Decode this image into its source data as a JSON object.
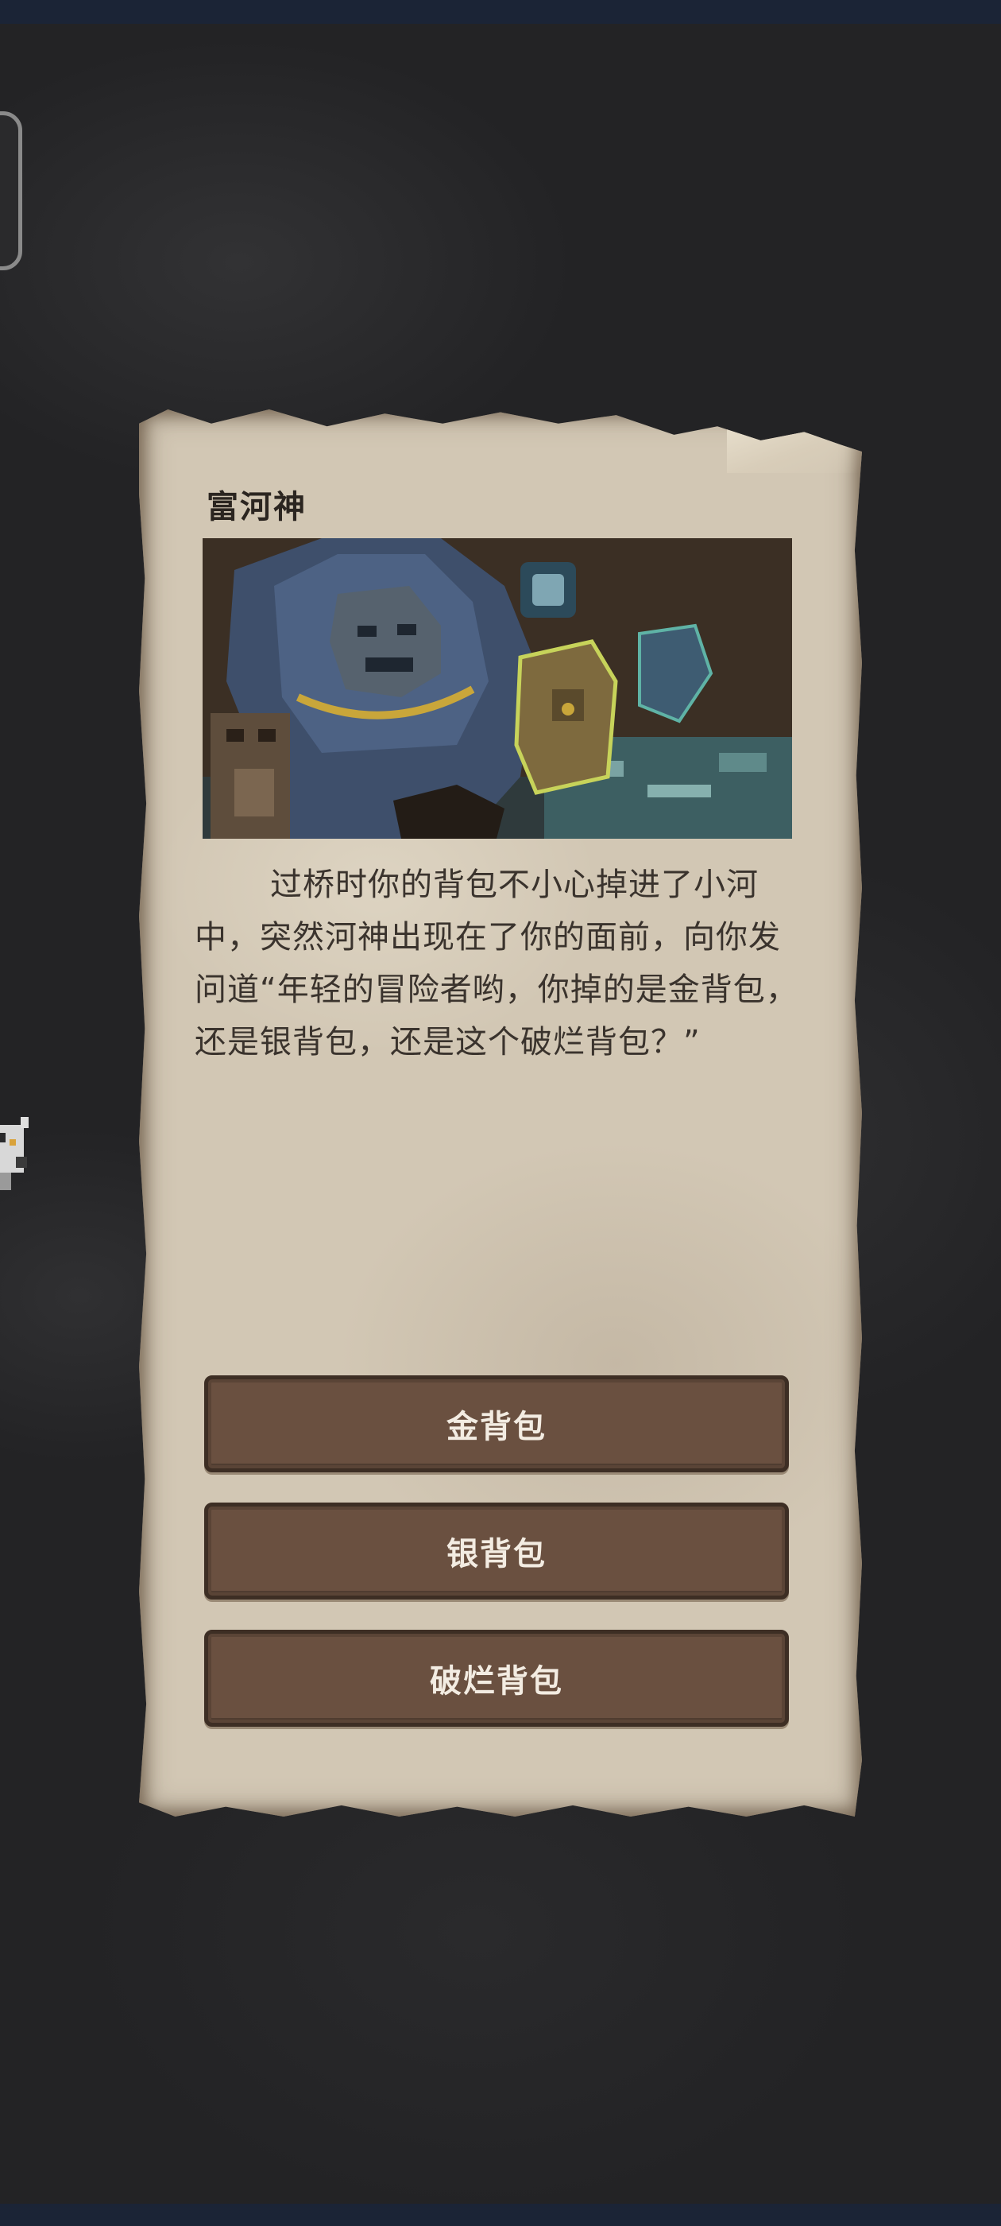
{
  "event": {
    "title": "富河神",
    "description": "过桥时你的背包不小心掉进了小河中，突然河神出现在了你的面前，向你发问道“年轻的冒险者哟，你掉的是金背包，还是银背包，还是这个破烂背包？”"
  },
  "choices": [
    {
      "label": "金背包"
    },
    {
      "label": "银背包"
    },
    {
      "label": "破烂背包"
    }
  ],
  "colors": {
    "parchment": "#d2c7b4",
    "button": "#6a5040",
    "button_text": "#f3ece2",
    "title_text": "#2b2520",
    "body_text": "#3a332d",
    "background": "#232325",
    "system_bar": "#1b2436"
  },
  "icons": {
    "side_tab": "side-menu-tab",
    "side_character": "knight-character-icon"
  }
}
